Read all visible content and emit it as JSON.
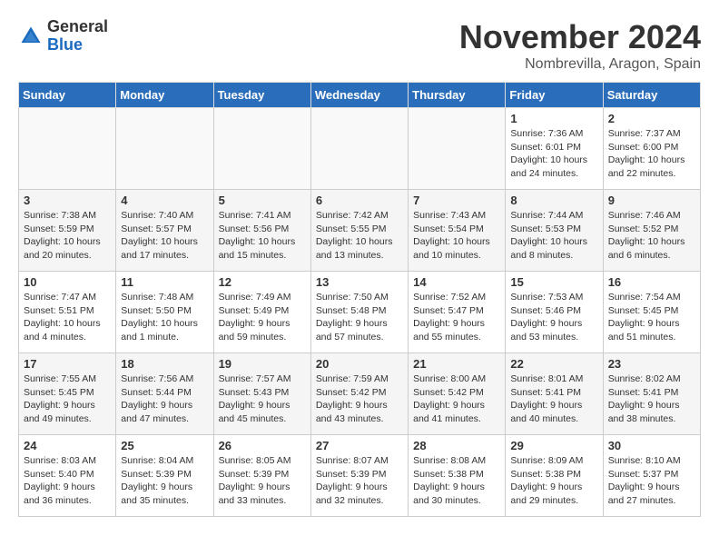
{
  "logo": {
    "general": "General",
    "blue": "Blue"
  },
  "title": "November 2024",
  "location": "Nombrevilla, Aragon, Spain",
  "days_of_week": [
    "Sunday",
    "Monday",
    "Tuesday",
    "Wednesday",
    "Thursday",
    "Friday",
    "Saturday"
  ],
  "weeks": [
    [
      {
        "num": "",
        "info": ""
      },
      {
        "num": "",
        "info": ""
      },
      {
        "num": "",
        "info": ""
      },
      {
        "num": "",
        "info": ""
      },
      {
        "num": "",
        "info": ""
      },
      {
        "num": "1",
        "info": "Sunrise: 7:36 AM\nSunset: 6:01 PM\nDaylight: 10 hours and 24 minutes."
      },
      {
        "num": "2",
        "info": "Sunrise: 7:37 AM\nSunset: 6:00 PM\nDaylight: 10 hours and 22 minutes."
      }
    ],
    [
      {
        "num": "3",
        "info": "Sunrise: 7:38 AM\nSunset: 5:59 PM\nDaylight: 10 hours and 20 minutes."
      },
      {
        "num": "4",
        "info": "Sunrise: 7:40 AM\nSunset: 5:57 PM\nDaylight: 10 hours and 17 minutes."
      },
      {
        "num": "5",
        "info": "Sunrise: 7:41 AM\nSunset: 5:56 PM\nDaylight: 10 hours and 15 minutes."
      },
      {
        "num": "6",
        "info": "Sunrise: 7:42 AM\nSunset: 5:55 PM\nDaylight: 10 hours and 13 minutes."
      },
      {
        "num": "7",
        "info": "Sunrise: 7:43 AM\nSunset: 5:54 PM\nDaylight: 10 hours and 10 minutes."
      },
      {
        "num": "8",
        "info": "Sunrise: 7:44 AM\nSunset: 5:53 PM\nDaylight: 10 hours and 8 minutes."
      },
      {
        "num": "9",
        "info": "Sunrise: 7:46 AM\nSunset: 5:52 PM\nDaylight: 10 hours and 6 minutes."
      }
    ],
    [
      {
        "num": "10",
        "info": "Sunrise: 7:47 AM\nSunset: 5:51 PM\nDaylight: 10 hours and 4 minutes."
      },
      {
        "num": "11",
        "info": "Sunrise: 7:48 AM\nSunset: 5:50 PM\nDaylight: 10 hours and 1 minute."
      },
      {
        "num": "12",
        "info": "Sunrise: 7:49 AM\nSunset: 5:49 PM\nDaylight: 9 hours and 59 minutes."
      },
      {
        "num": "13",
        "info": "Sunrise: 7:50 AM\nSunset: 5:48 PM\nDaylight: 9 hours and 57 minutes."
      },
      {
        "num": "14",
        "info": "Sunrise: 7:52 AM\nSunset: 5:47 PM\nDaylight: 9 hours and 55 minutes."
      },
      {
        "num": "15",
        "info": "Sunrise: 7:53 AM\nSunset: 5:46 PM\nDaylight: 9 hours and 53 minutes."
      },
      {
        "num": "16",
        "info": "Sunrise: 7:54 AM\nSunset: 5:45 PM\nDaylight: 9 hours and 51 minutes."
      }
    ],
    [
      {
        "num": "17",
        "info": "Sunrise: 7:55 AM\nSunset: 5:45 PM\nDaylight: 9 hours and 49 minutes."
      },
      {
        "num": "18",
        "info": "Sunrise: 7:56 AM\nSunset: 5:44 PM\nDaylight: 9 hours and 47 minutes."
      },
      {
        "num": "19",
        "info": "Sunrise: 7:57 AM\nSunset: 5:43 PM\nDaylight: 9 hours and 45 minutes."
      },
      {
        "num": "20",
        "info": "Sunrise: 7:59 AM\nSunset: 5:42 PM\nDaylight: 9 hours and 43 minutes."
      },
      {
        "num": "21",
        "info": "Sunrise: 8:00 AM\nSunset: 5:42 PM\nDaylight: 9 hours and 41 minutes."
      },
      {
        "num": "22",
        "info": "Sunrise: 8:01 AM\nSunset: 5:41 PM\nDaylight: 9 hours and 40 minutes."
      },
      {
        "num": "23",
        "info": "Sunrise: 8:02 AM\nSunset: 5:41 PM\nDaylight: 9 hours and 38 minutes."
      }
    ],
    [
      {
        "num": "24",
        "info": "Sunrise: 8:03 AM\nSunset: 5:40 PM\nDaylight: 9 hours and 36 minutes."
      },
      {
        "num": "25",
        "info": "Sunrise: 8:04 AM\nSunset: 5:39 PM\nDaylight: 9 hours and 35 minutes."
      },
      {
        "num": "26",
        "info": "Sunrise: 8:05 AM\nSunset: 5:39 PM\nDaylight: 9 hours and 33 minutes."
      },
      {
        "num": "27",
        "info": "Sunrise: 8:07 AM\nSunset: 5:39 PM\nDaylight: 9 hours and 32 minutes."
      },
      {
        "num": "28",
        "info": "Sunrise: 8:08 AM\nSunset: 5:38 PM\nDaylight: 9 hours and 30 minutes."
      },
      {
        "num": "29",
        "info": "Sunrise: 8:09 AM\nSunset: 5:38 PM\nDaylight: 9 hours and 29 minutes."
      },
      {
        "num": "30",
        "info": "Sunrise: 8:10 AM\nSunset: 5:37 PM\nDaylight: 9 hours and 27 minutes."
      }
    ]
  ]
}
